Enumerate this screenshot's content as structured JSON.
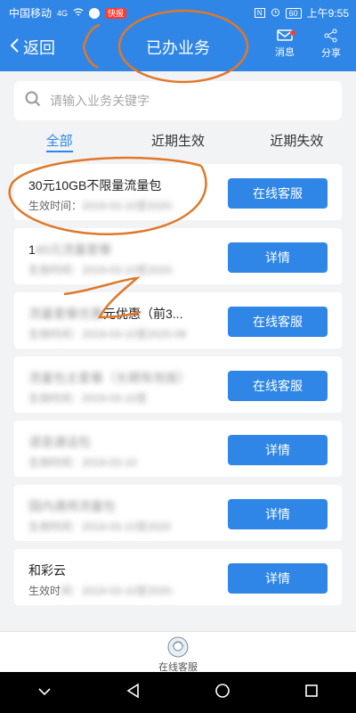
{
  "status": {
    "carrier": "中国移动",
    "signal": "4G",
    "app_badge": "快报",
    "time": "上午9:55",
    "battery": "60"
  },
  "header": {
    "back_label": "返回",
    "title": "已办业务",
    "message_label": "消息",
    "share_label": "分享"
  },
  "search": {
    "placeholder": "请输入业务关键字"
  },
  "tabs": [
    {
      "label": "全部"
    },
    {
      "label": "近期生效"
    },
    {
      "label": "近期失效"
    }
  ],
  "items": [
    {
      "name": "30元10GB不限量流量包",
      "time_prefix": "生效时间：",
      "time_blur": "2019-03-10至2020-",
      "button": "在线客服"
    },
    {
      "name": "1",
      "name_blur": "45元流量套餐",
      "time_blur": "生效时间：2019-03-10至2020-",
      "button": "详情"
    },
    {
      "name_blur": "流量套餐优惠",
      "name_suffix": "元优惠（前3...",
      "time_blur": "生效时间：2019-03-10至2020-06",
      "button": "在线客服"
    },
    {
      "name_blur": "流量包主套餐（长期有效版）",
      "time_blur": "生效时间：2019-03-10至",
      "button": "在线客服"
    },
    {
      "name_blur": "语音通话包",
      "time_blur": "生效时间：2019-03-10",
      "button": "详情"
    },
    {
      "name_blur": "国内通用流量包",
      "time_blur": "生效时间：2019-03-10至2020",
      "button": "详情"
    },
    {
      "name": "和彩云",
      "time_prefix": "生效时",
      "time_blur": "间：2019-03-10至2020-",
      "button": "详情"
    }
  ],
  "bottom": {
    "service_label": "在线客服"
  },
  "colors": {
    "brand": "#2f86e6",
    "background": "#f2f3f5",
    "annotation": "#e0782a"
  }
}
